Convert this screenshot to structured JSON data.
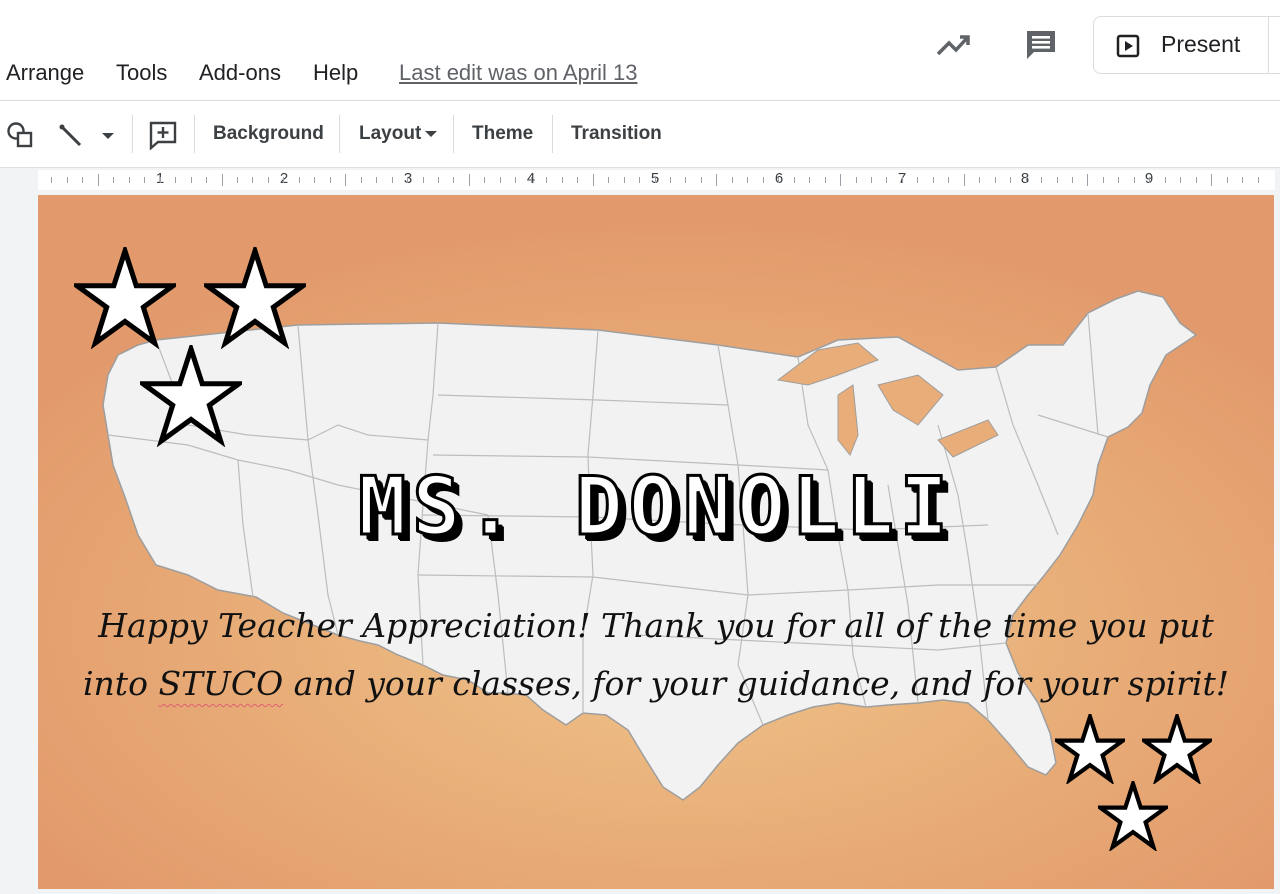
{
  "menu": {
    "items": [
      "Arrange",
      "Tools",
      "Add-ons",
      "Help"
    ],
    "last_edit": "Last edit was on April 13"
  },
  "header": {
    "present_label": "Present",
    "icons": [
      "activity-trend-icon",
      "comments-icon",
      "present-play-icon"
    ]
  },
  "toolbar": {
    "background_label": "Background",
    "layout_label": "Layout",
    "theme_label": "Theme",
    "transition_label": "Transition",
    "icons": [
      "shape-icon",
      "line-icon",
      "dropdown-caret-icon",
      "new-comment-icon"
    ]
  },
  "ruler": {
    "numbers": [
      "1",
      "2",
      "3",
      "4",
      "5",
      "6",
      "7",
      "8",
      "9"
    ]
  },
  "slide": {
    "title": "MS. DONOLLI",
    "message_before": "Happy Teacher Appreciation! Thank you for all of the time you put into ",
    "message_underlined": "STUCO",
    "message_after": " and your classes, for your guidance, and for your spirit!",
    "background_colors": [
      "#f0c48a",
      "#e29a6c"
    ],
    "map_fill": "#f2f2f2",
    "star_count": 6
  }
}
